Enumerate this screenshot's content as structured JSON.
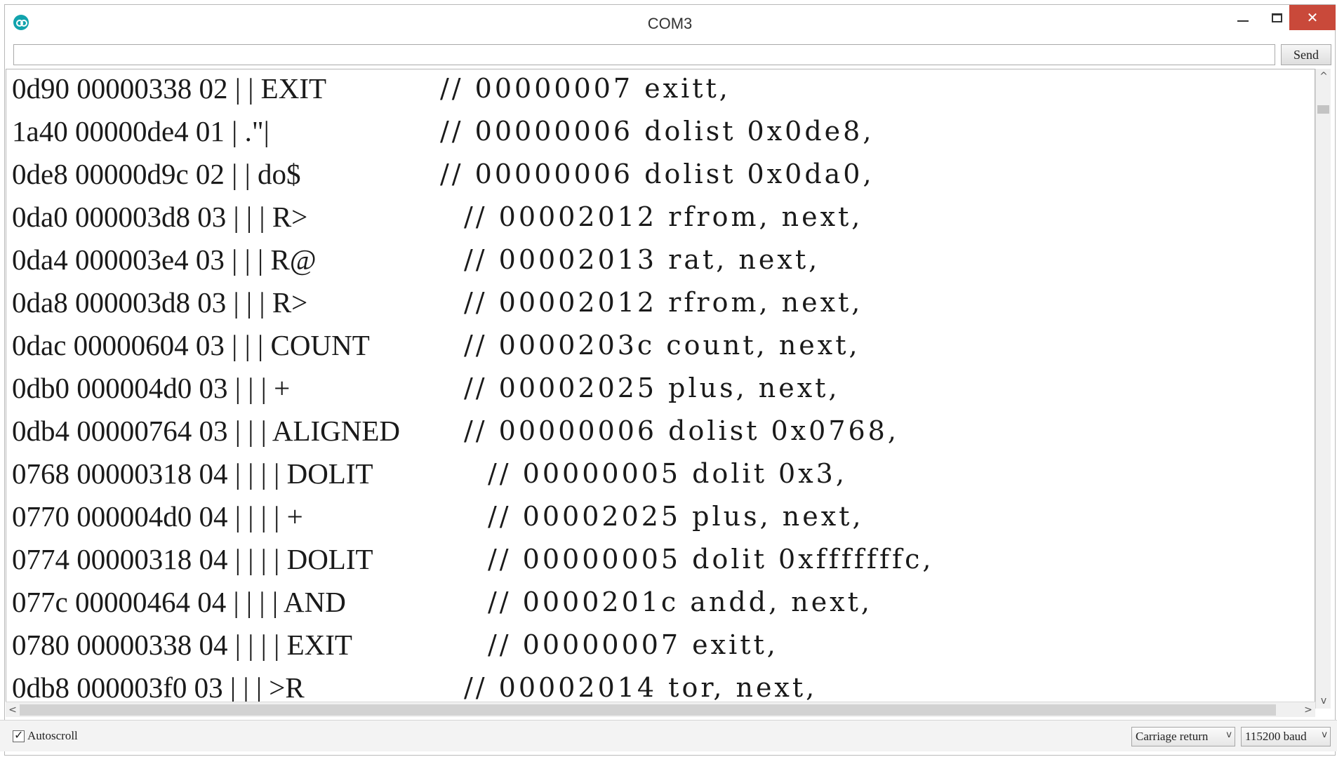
{
  "window": {
    "title": "COM3",
    "controls": {
      "minimize": "",
      "maximize": "",
      "close": "✕"
    }
  },
  "toolbar": {
    "input_value": "",
    "send_label": "Send"
  },
  "output": {
    "lines": [
      {
        "left": "0d90 00000338 02 | | EXIT",
        "right": "// 00000007 exitt,"
      },
      {
        "left": "1a40 00000de4 01 | .\"|",
        "right": "// 00000006 dolist 0x0de8,"
      },
      {
        "left": "0de8 00000d9c 02 | | do$",
        "right": "// 00000006 dolist 0x0da0,"
      },
      {
        "left": "0da0 000003d8 03 | | | R>",
        "right": "// 00002012 rfrom, next,"
      },
      {
        "left": "0da4 000003e4 03 | | | R@",
        "right": "// 00002013 rat, next,"
      },
      {
        "left": "0da8 000003d8 03 | | | R>",
        "right": "// 00002012 rfrom, next,"
      },
      {
        "left": "0dac 00000604 03 | | | COUNT",
        "right": "// 0000203c count, next,"
      },
      {
        "left": "0db0 000004d0 03 | | | +",
        "right": "// 00002025 plus, next,"
      },
      {
        "left": "0db4 00000764 03 | | | ALIGNED",
        "right": "// 00000006 dolist 0x0768,"
      },
      {
        "left": "0768 00000318 04 | | | | DOLIT",
        "right": "// 00000005 dolit 0x3,"
      },
      {
        "left": "0770 000004d0 04 | | | | +",
        "right": "// 00002025 plus, next,"
      },
      {
        "left": "0774 00000318 04 | | | | DOLIT",
        "right": "// 00000005 dolit 0xfffffffc,"
      },
      {
        "left": "077c 00000464 04 | | | | AND",
        "right": "// 0000201c andd, next,"
      },
      {
        "left": "0780 00000338 04 | | | | EXIT",
        "right": "// 00000007 exitt,"
      },
      {
        "left": "0db8 000003f0 03 | | | >R",
        "right": "// 00002014 tor, next,"
      }
    ]
  },
  "statusbar": {
    "autoscroll_label": "Autoscroll",
    "autoscroll_checked": true,
    "line_ending": "Carriage return",
    "baud_rate": "115200 baud"
  },
  "colors": {
    "close_button": "#c9493a",
    "app_icon": "#12a3ad"
  }
}
